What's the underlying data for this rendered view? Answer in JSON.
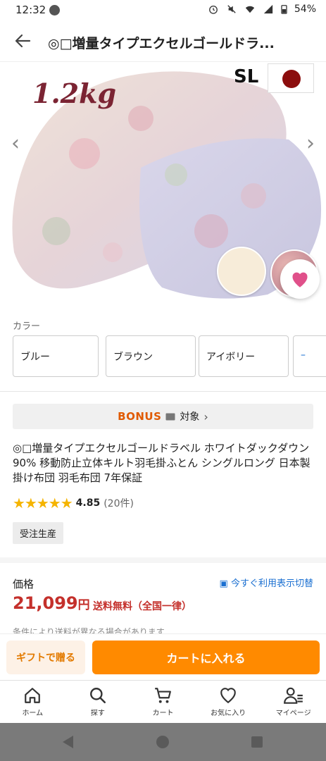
{
  "status_bar": {
    "time": "12:32",
    "battery": "54%"
  },
  "header": {
    "title": "◎□増量タイプエクセルゴールドラ..."
  },
  "hero": {
    "weight_label": "1.2kg",
    "size_label": "SL"
  },
  "colors": {
    "label": "カラー",
    "options": [
      "ブルー",
      "ブラウン",
      "アイボリー"
    ]
  },
  "bonus": {
    "badge": "BONUS",
    "label": "対象"
  },
  "product": {
    "name": "◎□増量タイプエクセルゴールドラベル ホワイトダックダウン90% 移動防止立体キルト羽毛掛ふとん シングルロング 日本製 掛け布団 羽毛布団 7年保証",
    "rating": {
      "stars": 5,
      "score": "4.85",
      "count": "(20件)"
    },
    "tag": "受注生産"
  },
  "price": {
    "label": "価格",
    "tax_toggle": "今すぐ利用表示切替",
    "amount": "21,099",
    "currency": "円",
    "shipping": "送料無料（全国一律）",
    "note": "条件により送料が異なる場合があります"
  },
  "actions": {
    "gift": "ギフトで贈る",
    "add_to_cart": "カートに入れる"
  },
  "bottom_nav": [
    {
      "label": "ホーム",
      "icon": "home-icon"
    },
    {
      "label": "探す",
      "icon": "search-icon"
    },
    {
      "label": "カート",
      "icon": "cart-icon"
    },
    {
      "label": "お気に入り",
      "icon": "heart-icon"
    },
    {
      "label": "マイページ",
      "icon": "user-icon"
    }
  ],
  "theme": {
    "accent": "#ff8a00",
    "price_red": "#c4302b",
    "link_blue": "#1a6fd1"
  }
}
